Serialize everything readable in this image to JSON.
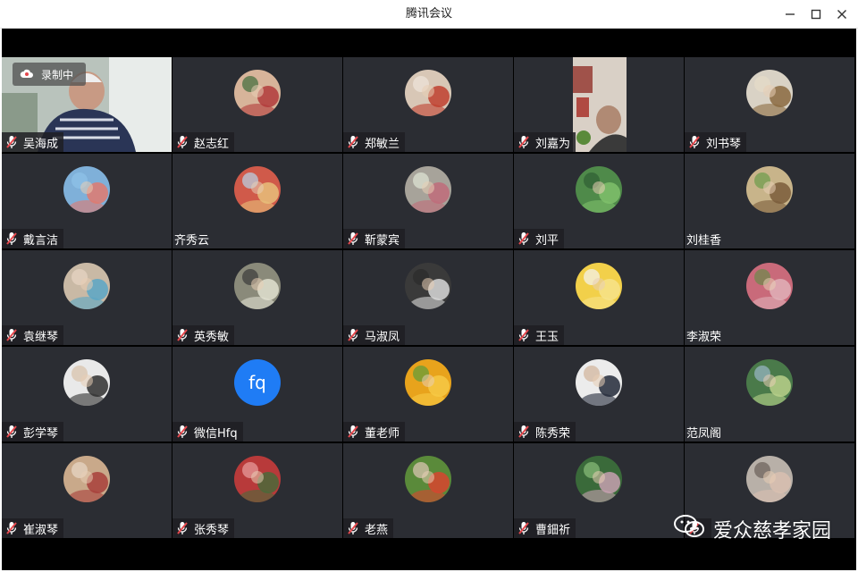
{
  "window": {
    "title": "腾讯会议"
  },
  "recording": {
    "label": "录制中"
  },
  "watermark": {
    "text": "爱众慈孝家园"
  },
  "colors": {
    "muted_mic": "#e5484d",
    "tile_bg": "#2b2d33",
    "letter_avatar": "#1f7cf5"
  },
  "participants": [
    {
      "name": "吴海成",
      "muted": true,
      "mode": "video"
    },
    {
      "name": "赵志红",
      "muted": true,
      "mode": "avatar"
    },
    {
      "name": "郑敏兰",
      "muted": true,
      "mode": "avatar"
    },
    {
      "name": "刘嘉为",
      "muted": true,
      "mode": "video"
    },
    {
      "name": "刘书琴",
      "muted": true,
      "mode": "avatar"
    },
    {
      "name": "戴言洁",
      "muted": true,
      "mode": "avatar"
    },
    {
      "name": "齐秀云",
      "muted": false,
      "mode": "avatar"
    },
    {
      "name": "靳蒙宾",
      "muted": true,
      "mode": "avatar"
    },
    {
      "name": "刘平",
      "muted": true,
      "mode": "avatar"
    },
    {
      "name": "刘桂香",
      "muted": false,
      "mode": "avatar"
    },
    {
      "name": "袁继琴",
      "muted": true,
      "mode": "avatar"
    },
    {
      "name": "英秀敏",
      "muted": true,
      "mode": "avatar"
    },
    {
      "name": "马淑凤",
      "muted": true,
      "mode": "avatar"
    },
    {
      "name": "王玉",
      "muted": true,
      "mode": "avatar"
    },
    {
      "name": "李淑荣",
      "muted": false,
      "mode": "avatar"
    },
    {
      "name": "彭学琴",
      "muted": true,
      "mode": "avatar"
    },
    {
      "name": "微信Hfq",
      "muted": true,
      "mode": "letter",
      "initials": "fq"
    },
    {
      "name": "董老师",
      "muted": true,
      "mode": "avatar"
    },
    {
      "name": "陈秀荣",
      "muted": true,
      "mode": "avatar"
    },
    {
      "name": "范凤阁",
      "muted": false,
      "mode": "avatar"
    },
    {
      "name": "崔淑琴",
      "muted": true,
      "mode": "avatar"
    },
    {
      "name": "张秀琴",
      "muted": true,
      "mode": "avatar"
    },
    {
      "name": "老燕",
      "muted": true,
      "mode": "avatar"
    },
    {
      "name": "曹鈿祈",
      "muted": true,
      "mode": "avatar"
    },
    {
      "name": "",
      "muted": true,
      "mode": "avatar"
    }
  ]
}
